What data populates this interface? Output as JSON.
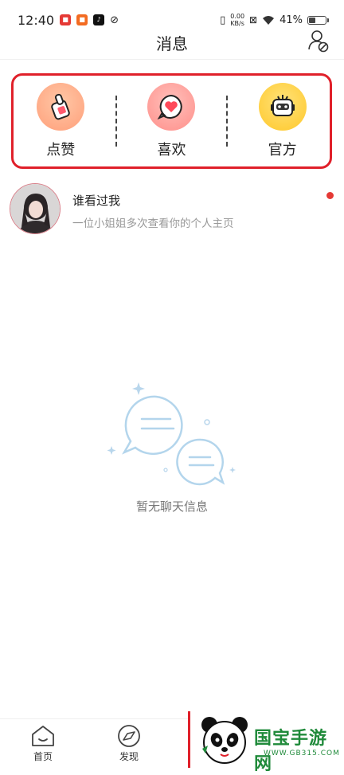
{
  "status_bar": {
    "time": "12:40",
    "net_speed_value": "0.00",
    "net_speed_unit": "KB/s",
    "battery_percent": "41%",
    "battery_level": 0.41
  },
  "header": {
    "title": "消息"
  },
  "categories": [
    {
      "label": "点赞",
      "icon": "thumbs-up-icon",
      "color": "#ffb089"
    },
    {
      "label": "喜欢",
      "icon": "heart-chat-icon",
      "color": "#ffa5a0"
    },
    {
      "label": "官方",
      "icon": "robot-icon",
      "color": "#ffd54a"
    }
  ],
  "visitor": {
    "title": "谁看过我",
    "subtitle": "一位小姐姐多次查看你的个人主页",
    "unread": true
  },
  "empty_state": {
    "text": "暂无聊天信息"
  },
  "bottom_nav": {
    "items": [
      {
        "label": "首页",
        "icon": "home-icon"
      },
      {
        "label": "发现",
        "icon": "discover-icon"
      }
    ]
  },
  "watermark": {
    "title": "国宝手游网",
    "url": "WWW.GB315.COM"
  }
}
